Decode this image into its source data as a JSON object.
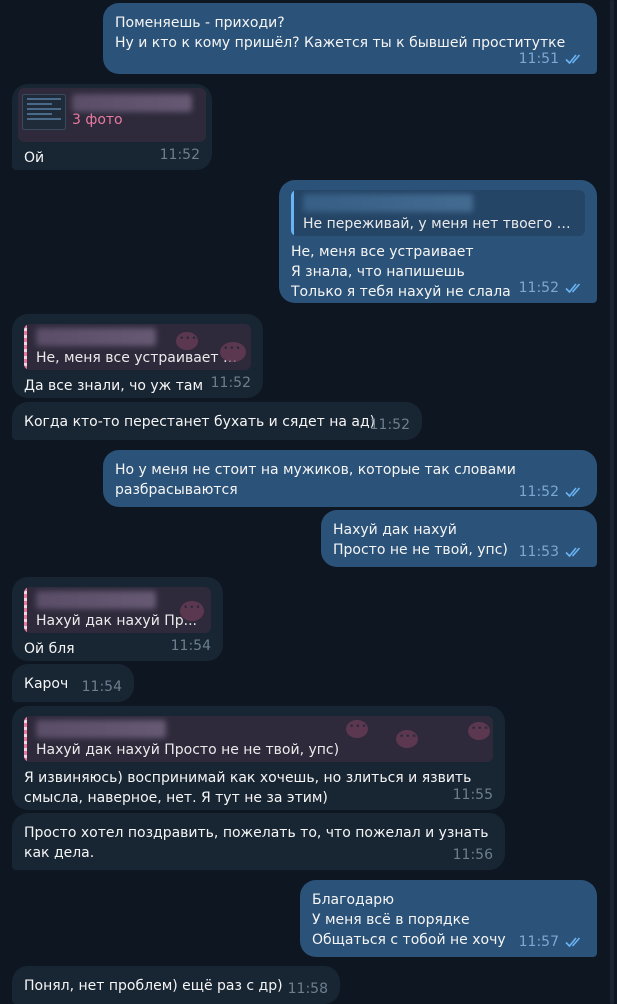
{
  "messages": [
    {
      "lines": [
        "Поменяешь - приходи?",
        "Ну и кто к кому пришёл? Кажется ты к бывшей проститутке"
      ],
      "time": "11:51"
    },
    {
      "reply": {
        "text": "3 фото"
      },
      "lines": [
        "Ой"
      ],
      "time": "11:52"
    },
    {
      "reply": {
        "text": "Не переживай, у меня нет твоего н..."
      },
      "lines": [
        "Не, меня все устраивает",
        "Я знала, что напишешь",
        "Только я тебя нахуй не слала"
      ],
      "time": "11:52"
    },
    {
      "reply": {
        "text": "Не, меня все устраивает Я..."
      },
      "lines": [
        "Да все знали, чо уж там"
      ],
      "time": "11:52"
    },
    {
      "lines": [
        "Когда кто-то перестанет бухать и сядет на ад)"
      ],
      "time": "11:52"
    },
    {
      "lines": [
        "Но у меня не стоит на мужиков, которые так словами",
        "разбрасываются"
      ],
      "time": "11:52"
    },
    {
      "lines": [
        "Нахуй дак нахуй",
        "Просто не не твой, упс)"
      ],
      "time": "11:53"
    },
    {
      "reply": {
        "text": "Нахуй дак нахуй Пр..."
      },
      "lines": [
        "Ой бля"
      ],
      "time": "11:54"
    },
    {
      "lines": [
        "Кароч"
      ],
      "time": "11:54"
    },
    {
      "reply": {
        "text": "Нахуй дак нахуй Просто не не твой, упс)"
      },
      "lines": [
        "Я извиняюсь) воспринимай как хочешь, но злиться и язвить",
        "смысла, наверное, нет. Я тут не за этим)"
      ],
      "time": "11:55"
    },
    {
      "lines": [
        "Просто хотел поздравить, пожелать то, что пожелал и узнать",
        "как дела."
      ],
      "time": "11:56"
    },
    {
      "lines": [
        "Благодарю",
        "У меня всё в порядке",
        "Общаться с тобой не хочу"
      ],
      "time": "11:57"
    },
    {
      "lines": [
        "Понял, нет проблем) ещё раз с др)"
      ],
      "time": "11:58"
    }
  ]
}
